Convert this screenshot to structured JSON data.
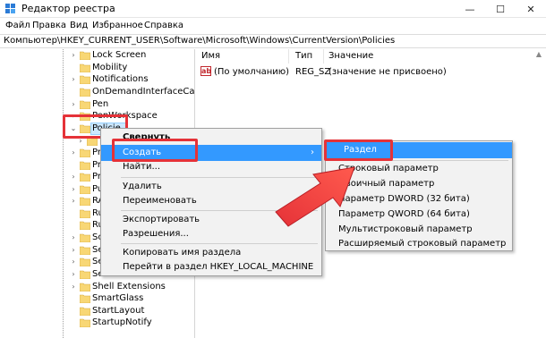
{
  "window": {
    "title": "Редактор реестра",
    "minimize_glyph": "—",
    "maximize_glyph": "☐",
    "close_glyph": "✕"
  },
  "menu": [
    "Файл",
    "Правка",
    "Вид",
    "Избранное",
    "Справка"
  ],
  "address": "Компьютер\\HKEY_CURRENT_USER\\Software\\Microsoft\\Windows\\CurrentVersion\\Policies",
  "tree": {
    "items": [
      {
        "label": "Lock Screen",
        "expander": "›"
      },
      {
        "label": "Mobility",
        "expander": ""
      },
      {
        "label": "Notifications",
        "expander": "›"
      },
      {
        "label": "OnDemandInterfaceCach",
        "expander": ""
      },
      {
        "label": "Pen",
        "expander": "›"
      },
      {
        "label": "PenWorkspace",
        "expander": "›"
      },
      {
        "label": "Policie",
        "expander": "⌄"
      },
      {
        "label": "Exp",
        "expander": "›"
      },
      {
        "label": "Precis",
        "expander": "›"
      },
      {
        "label": "Prelau",
        "expander": ""
      },
      {
        "label": "Privac",
        "expander": "›"
      },
      {
        "label": "PushN",
        "expander": "›"
      },
      {
        "label": "RADA",
        "expander": "›"
      },
      {
        "label": "Run",
        "expander": ""
      },
      {
        "label": "RunO",
        "expander": ""
      },
      {
        "label": "Screen",
        "expander": "›"
      },
      {
        "label": "Search",
        "expander": "›"
      },
      {
        "label": "Securi",
        "expander": "›"
      },
      {
        "label": "Settin",
        "expander": "›"
      },
      {
        "label": "Shell Extensions",
        "expander": "›"
      },
      {
        "label": "SmartGlass",
        "expander": ""
      },
      {
        "label": "StartLayout",
        "expander": ""
      },
      {
        "label": "StartupNotify",
        "expander": ""
      }
    ]
  },
  "values": {
    "columns": [
      "Имя",
      "Тип",
      "Значение"
    ],
    "rows": [
      {
        "name": "(По умолчанию)",
        "type": "REG_SZ",
        "value": "(значение не присвоено)",
        "icon": "string-value-icon"
      }
    ]
  },
  "context_menu": {
    "items": [
      "Свернуть",
      "Создать",
      "Найти...",
      "Удалить",
      "Переименовать",
      "Экспортировать",
      "Разрешения...",
      "Копировать имя раздела",
      "Перейти в раздел HKEY_LOCAL_MACHINE"
    ],
    "submenu_arrow": "›"
  },
  "submenu": {
    "items": [
      "Раздел",
      "Строковый параметр",
      "Двоичный параметр",
      "Параметр DWORD (32 бита)",
      "Параметр QWORD (64 бита)",
      "Мультистроковый параметр",
      "Расширяемый строковый параметр"
    ]
  },
  "colors": {
    "highlight": "#3399ff",
    "annotation_red": "#e53238",
    "folder_yellow": "#f8d775"
  }
}
